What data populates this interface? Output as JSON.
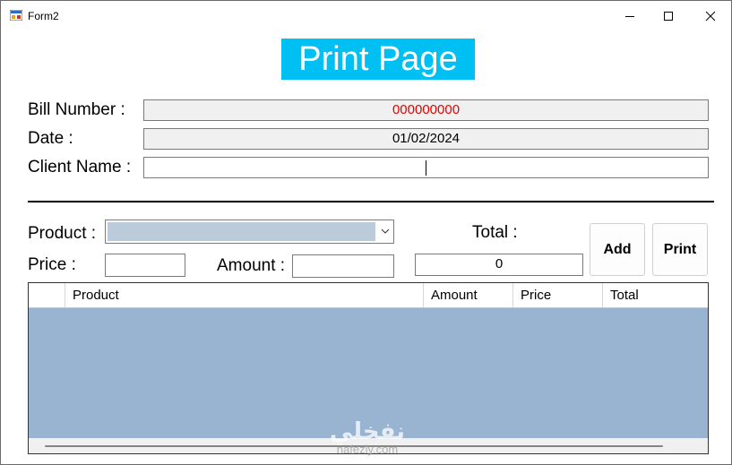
{
  "window": {
    "title": "Form2"
  },
  "header": {
    "title": "Print Page"
  },
  "form": {
    "bill_label": "Bill Number :",
    "bill_value": "000000000",
    "date_label": "Date :",
    "date_value": "01/02/2024",
    "client_label": "Client Name :",
    "client_value": ""
  },
  "entry": {
    "product_label": "Product :",
    "product_value": "",
    "price_label": "Price :",
    "price_value": "",
    "amount_label": "Amount :",
    "amount_value": "",
    "total_label": "Total :",
    "total_value": "0",
    "add_label": "Add",
    "print_label": "Print"
  },
  "grid": {
    "columns": [
      "Product",
      "Amount",
      "Price",
      "Total"
    ]
  },
  "watermark": {
    "main": "نفخلي",
    "sub": "nafezly.com"
  },
  "colors": {
    "title_bg": "#00bff3",
    "bill_text": "#e00000",
    "grid_bg": "#99b4d1",
    "combo_fill": "#bccbd9"
  }
}
